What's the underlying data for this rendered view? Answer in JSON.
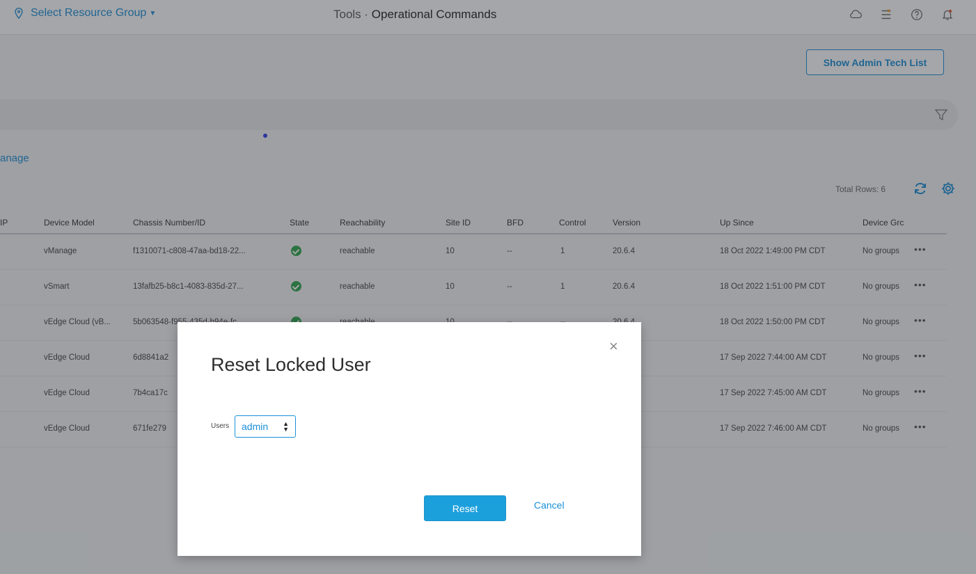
{
  "header": {
    "resource_group": "Select Resource Group",
    "title_prefix": "Tools · ",
    "title_main": "Operational Commands",
    "icons": [
      "cloud-icon",
      "tasks-icon",
      "help-icon",
      "bell-icon"
    ]
  },
  "toolbar": {
    "admin_tech_label": "Show Admin Tech List",
    "vmanage_link": "anage",
    "total_rows": "Total Rows: 6"
  },
  "table": {
    "headers": [
      "IP",
      "Device Model",
      "Chassis Number/ID",
      "State",
      "Reachability",
      "Site ID",
      "BFD",
      "Control",
      "Version",
      "Up Since",
      "Device Grc"
    ],
    "rows": [
      {
        "model": "vManage",
        "chassis": "f1310071-c808-47aa-bd18-22...",
        "reach": "reachable",
        "site": "10",
        "bfd": "--",
        "control": "1",
        "version": "20.6.4",
        "up": "18 Oct 2022 1:49:00 PM CDT",
        "group": "No groups",
        "more": "•••"
      },
      {
        "model": "vSmart",
        "chassis": "13fafb25-b8c1-4083-835d-27...",
        "reach": "reachable",
        "site": "10",
        "bfd": "--",
        "control": "1",
        "version": "20.6.4",
        "up": "18 Oct 2022 1:51:00 PM CDT",
        "group": "No groups",
        "more": "•••"
      },
      {
        "model": "vEdge Cloud (vB...",
        "chassis": "5b063548-f955-435d-b94e-fc...",
        "reach": "reachable",
        "site": "10",
        "bfd": "--",
        "control": "--",
        "version": "20.6.4",
        "up": "18 Oct 2022 1:50:00 PM CDT",
        "group": "No groups",
        "more": "•••"
      },
      {
        "model": "vEdge Cloud",
        "chassis": "6d8841a2",
        "reach": "",
        "site": "",
        "bfd": "",
        "control": "",
        "version": "",
        "up": "17 Sep 2022 7:44:00 AM CDT",
        "group": "No groups",
        "more": "•••"
      },
      {
        "model": "vEdge Cloud",
        "chassis": "7b4ca17c",
        "reach": "",
        "site": "",
        "bfd": "",
        "control": "",
        "version": "",
        "up": "17 Sep 2022 7:45:00 AM CDT",
        "group": "No groups",
        "more": "•••"
      },
      {
        "model": "vEdge Cloud",
        "chassis": "671fe279",
        "reach": "",
        "site": "",
        "bfd": "",
        "control": "",
        "version": "",
        "up": "17 Sep 2022 7:46:00 AM CDT",
        "group": "No groups",
        "more": "•••"
      }
    ]
  },
  "modal": {
    "title": "Reset Locked User",
    "close": "×",
    "users_label": "Users",
    "users_value": "admin",
    "reset_label": "Reset",
    "cancel_label": "Cancel"
  },
  "colors": {
    "accent": "#1a8fd8",
    "reset_button": "#1ca0dc",
    "state_ok": "#2fa84f"
  }
}
